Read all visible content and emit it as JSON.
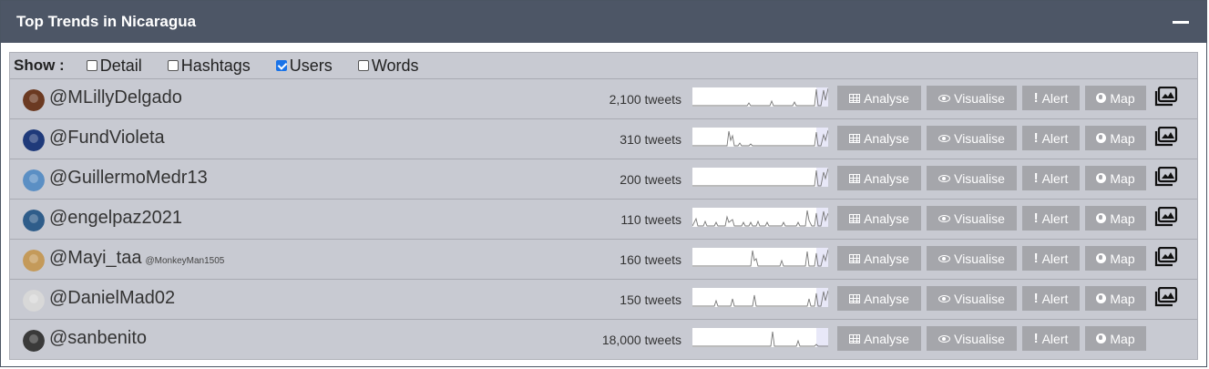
{
  "header": {
    "title": "Top Trends in Nicaragua"
  },
  "show": {
    "label": "Show :",
    "options": [
      {
        "label": "Detail",
        "checked": false
      },
      {
        "label": "Hashtags",
        "checked": false
      },
      {
        "label": "Users",
        "checked": true
      },
      {
        "label": "Words",
        "checked": false
      }
    ]
  },
  "buttons": {
    "analyse": "Analyse",
    "visualise": "Visualise",
    "alert": "Alert",
    "map": "Map"
  },
  "rows": [
    {
      "user": "@MLillyDelgado",
      "secondary": "",
      "count": "2,100 tweets",
      "has_image_button": true,
      "avatar_color": "#6b3a22"
    },
    {
      "user": "@FundVioleta",
      "secondary": "",
      "count": "310 tweets",
      "has_image_button": true,
      "avatar_color": "#1f3a7a"
    },
    {
      "user": "@GuillermoMedr13",
      "secondary": "",
      "count": "200 tweets",
      "has_image_button": true,
      "avatar_color": "#5b8fc4"
    },
    {
      "user": "@engelpaz2021",
      "secondary": "",
      "count": "110 tweets",
      "has_image_button": true,
      "avatar_color": "#2f5d8a"
    },
    {
      "user": "@Mayi_taa",
      "secondary": "@MonkeyMan1505",
      "count": "160 tweets",
      "has_image_button": true,
      "avatar_color": "#c49a5a"
    },
    {
      "user": "@DanielMad02",
      "secondary": "",
      "count": "150 tweets",
      "has_image_button": true,
      "avatar_color": "#d8d8d8"
    },
    {
      "user": "@sanbenito",
      "secondary": "",
      "count": "18,000 tweets",
      "has_image_button": false,
      "avatar_color": "#3a3a3a"
    }
  ],
  "colors": {
    "header_bg": "#4d5666",
    "content_bg": "#c8cad2",
    "button_bg": "#a5a6ab"
  }
}
